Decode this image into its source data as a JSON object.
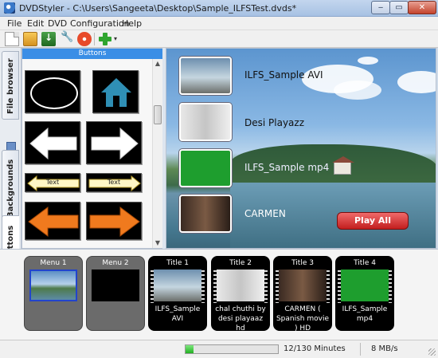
{
  "window": {
    "title": "DVDStyler - C:\\Users\\Sangeeta\\Desktop\\Sample_ILFSTest.dvds*",
    "minimize": "‒",
    "maximize": "▭",
    "close": "✕"
  },
  "menu": [
    "File",
    "Edit",
    "DVD",
    "Configuration",
    "Help"
  ],
  "toolbar": {
    "icons": [
      "new-icon",
      "open-icon",
      "save-icon",
      "settings-icon",
      "burn-icon",
      "add-icon"
    ],
    "dropdown": "▾"
  },
  "sidetabs": [
    "File browser",
    "Backgrounds",
    "Buttons"
  ],
  "panel": {
    "header": "Buttons",
    "text_button_label": "Text"
  },
  "scroll": {
    "up": "▲",
    "down": "▼"
  },
  "preview": {
    "items": [
      "ILFS_Sample AVI",
      "Desi Playazz",
      "ILFS_Sample mp4",
      "CARMEN"
    ],
    "play_all": "Play All"
  },
  "titleset": [
    {
      "title": "Menu 1",
      "desc": ""
    },
    {
      "title": "Menu 2",
      "desc": ""
    },
    {
      "title": "Title 1",
      "desc": "ILFS_Sample AVI"
    },
    {
      "title": "Title 2",
      "desc": "chal chuthi by desi playaaz hd"
    },
    {
      "title": "Title 3",
      "desc": "CARMEN ( Spanish movie ) HD"
    },
    {
      "title": "Title 4",
      "desc": "ILFS_Sample mp4"
    }
  ],
  "status": {
    "minutes": "12/130 Minutes",
    "speed": "8 MB/s",
    "progress_fraction": 0.09
  },
  "colors": {
    "accent": "#3a8ee6",
    "play_all": "#c21e1e",
    "progress": "#22b022"
  }
}
